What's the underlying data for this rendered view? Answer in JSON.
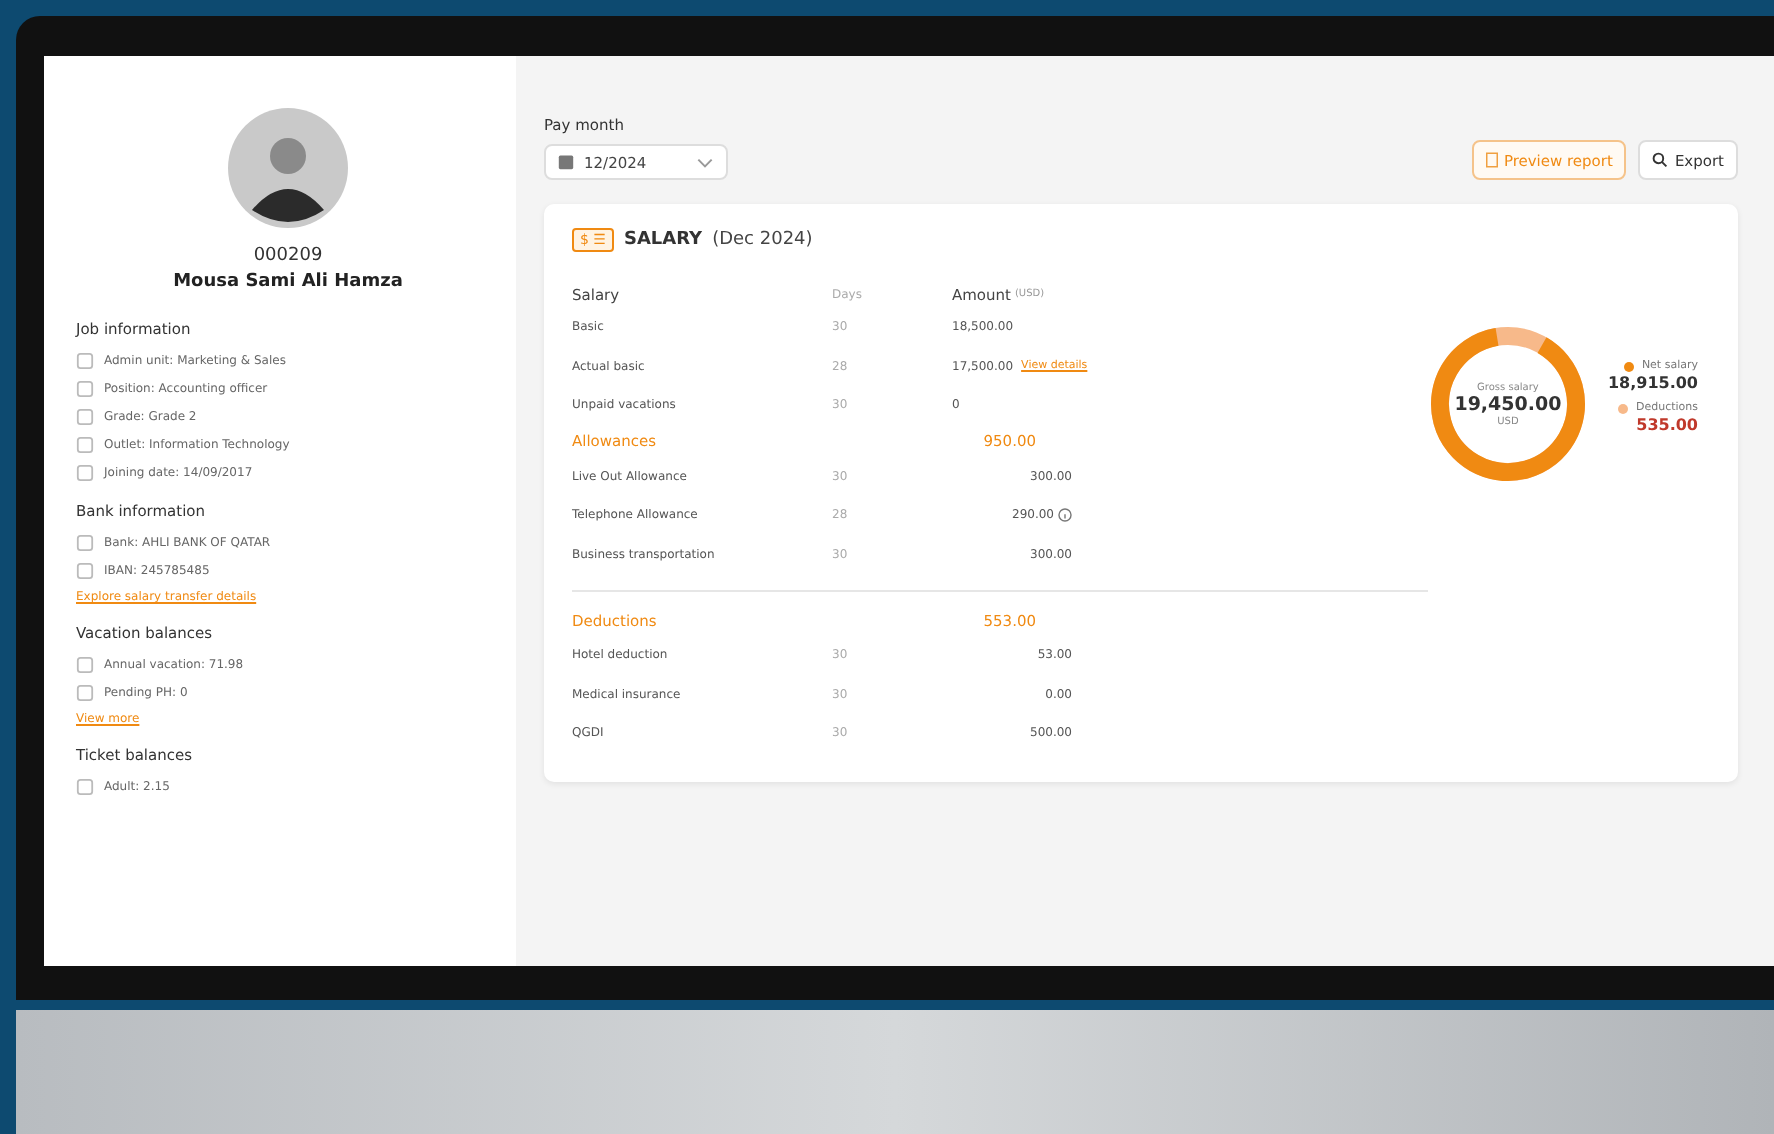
{
  "profile": {
    "employee_id": "000209",
    "name": "Mousa Sami Ali Hamza"
  },
  "sidebar_sections": [
    {
      "title": "Job information",
      "items": [
        "Admin unit: Marketing & Sales",
        "Position: Accounting officer",
        "Grade: Grade 2",
        "Outlet: Information Technology",
        "Joining date: 14/09/2017"
      ]
    },
    {
      "title": "Bank information",
      "items": [
        "Bank: AHLI BANK OF QATAR",
        "IBAN: 245785485"
      ],
      "link": "Explore salary transfer details"
    },
    {
      "title": "Vacation balances",
      "items": [
        "Annual vacation: 71.98",
        "Pending PH: 0"
      ],
      "link": "View more"
    },
    {
      "title": "Ticket balances",
      "items": [
        "Adult: 2.15"
      ]
    }
  ],
  "pay_month": {
    "label": "Pay month",
    "value": "12/2024"
  },
  "buttons": [
    {
      "label": "Preview report",
      "kind": "primary"
    },
    {
      "label": "Export",
      "kind": "secondary"
    }
  ],
  "card": {
    "badge": "$ ☰",
    "title": "SALARY",
    "period": "(Dec 2024)"
  },
  "salary": {
    "label": "Salary",
    "days": "Days",
    "amount": "Amount",
    "unit": "(USD)",
    "rows": [
      {
        "label": "Basic",
        "days": "30",
        "amount": "18,500.00"
      },
      {
        "label": "Actual basic",
        "days": "28",
        "amount": "17,500.00",
        "link": "View details"
      },
      {
        "label": "Unpaid vacations",
        "days": "30",
        "amount": "0"
      }
    ]
  },
  "groups": [
    {
      "title": "Allowances",
      "total": "950.00",
      "rows": [
        {
          "label": "Live Out Allowance",
          "days": "30",
          "amount": "300.00",
          "info": false
        },
        {
          "label": "Telephone Allowance",
          "days": "28",
          "amount": "290.00",
          "info": true
        },
        {
          "label": "Business transportation",
          "days": "30",
          "amount": "300.00",
          "info": false
        }
      ]
    },
    {
      "title": "Deductions",
      "total": "553.00",
      "rows": [
        {
          "label": "Hotel deduction",
          "days": "30",
          "amount": "53.00",
          "info": false
        },
        {
          "label": "Medical insurance",
          "days": "30",
          "amount": "0.00",
          "info": false
        },
        {
          "label": "QGDI",
          "days": "30",
          "amount": "500.00",
          "info": false
        }
      ]
    }
  ],
  "summary": {
    "center_label": "Gross salary",
    "center_value": "19,450.00",
    "center_unit": "USD",
    "legend": [
      {
        "label": "Net salary",
        "value": "18,915.00",
        "color": "#f08a12"
      },
      {
        "label": "Deductions",
        "value": "535.00",
        "color": "#f7b98a"
      }
    ]
  }
}
